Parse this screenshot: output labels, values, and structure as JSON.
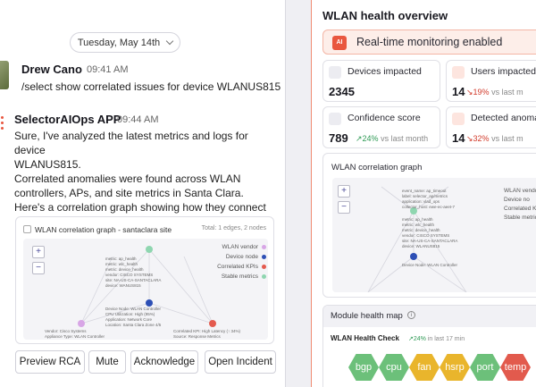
{
  "chat": {
    "date": "Tuesday, May 14th",
    "messages": [
      {
        "sender": "Drew Cano",
        "time": "09:41 AM",
        "text": "/select show correlated issues for device WLANUS815"
      },
      {
        "sender": "SelectorAIOps APP",
        "time": "09:44 AM",
        "lines": [
          "Sure, I've analyzed the latest metrics and logs for device",
          "WLANUS815.",
          "Correlated anomalies were found across WLAN",
          "controllers, APs, and site metrics in Santa Clara.",
          "Here's a correlation graph showing how they connect"
        ]
      }
    ],
    "graph_card": {
      "title": "WLAN correlation graph - santaclara site",
      "meta": "Total: 1 edges, 2 nodes",
      "zoom_in": "+",
      "zoom_out": "−",
      "legend": [
        {
          "label": "WLAN vendor",
          "color": "#d8a6e6"
        },
        {
          "label": "Device node",
          "color": "#2d4fb5"
        },
        {
          "label": "Correlated KPIs",
          "color": "#e45b4f"
        },
        {
          "label": "Stable metrics",
          "color": "#8fd6b0"
        }
      ],
      "node_labels": {
        "top": [
          "metric: ap_health",
          "metric: wlc_health",
          "metric: device_health",
          "vendor: CISCO SYSTEMS",
          "site: NA-US-CA-SANTACLARA",
          "device: WANUS815"
        ],
        "device": [
          "Device Node: WLAN Controller",
          "CPU Utilization: High (95%)",
          "Application: Network Core",
          "Location: Santa Clara Zone 4/5"
        ],
        "left": [
          "Vendor: Cisco Systems",
          "Appliance Type: WLAN Controller"
        ],
        "right": [
          "Correlated KPI: High Latency (↑ 34%)",
          "Source: Response Metrics"
        ]
      }
    },
    "actions": [
      "Preview RCA",
      "Mute",
      "Acknowledge",
      "Open Incident"
    ]
  },
  "panel": {
    "title": "WLAN health overview",
    "banner": "Real-time monitoring enabled",
    "banner_icon": "AI",
    "stats": [
      {
        "label": "Devices impacted",
        "value": "2345",
        "trend": "",
        "icon": "device-icon"
      },
      {
        "label": "Users impacted",
        "value": "14",
        "trend": "19%",
        "trend_suffix": "vs last m",
        "direction": "down",
        "icon": "users-icon"
      },
      {
        "label": "Confidence score",
        "value": "789",
        "trend": "24%",
        "trend_suffix": "vs last month",
        "direction": "up",
        "icon": "barcode-icon"
      },
      {
        "label": "Detected anomalie",
        "value": "14",
        "trend": "32%",
        "trend_suffix": "vs last m",
        "direction": "down",
        "icon": "anomaly-icon"
      }
    ],
    "correlation": {
      "title": "WLAN correlation graph",
      "zoom_in": "+",
      "zoom_out": "−",
      "legend": [
        "WLAN vendo",
        "Device no",
        "Correlated K",
        "Stable metric"
      ],
      "node_labels": {
        "top": [
          "event_name: ap_timeout",
          "label: selector_ap/metrics",
          "application: vlad_ops",
          "collector_host: ewe-ec-aeet-7"
        ],
        "middle": [
          "metric: ap_health",
          "metric: wlc_health",
          "metric: device_health",
          "vendor: CISCO SYSTEMS",
          "site: NA-US-CA-SANTACLARA",
          "device: WLANUS815"
        ],
        "device": "Device Node: WLAN Controller"
      }
    },
    "module": {
      "title": "Module health map",
      "check_title": "WLAN Health Check",
      "check_trend": "24%",
      "check_suffix": "in last 17 min",
      "hexes": [
        {
          "label": "bgp",
          "color": "#6cc07a"
        },
        {
          "label": "cpu",
          "color": "#6cc07a"
        },
        {
          "label": "fan",
          "color": "#e9b52c"
        },
        {
          "label": "hsrp",
          "color": "#e9b52c"
        },
        {
          "label": "port",
          "color": "#6cc07a"
        },
        {
          "label": "temp",
          "color": "#e25a4d"
        }
      ]
    }
  }
}
